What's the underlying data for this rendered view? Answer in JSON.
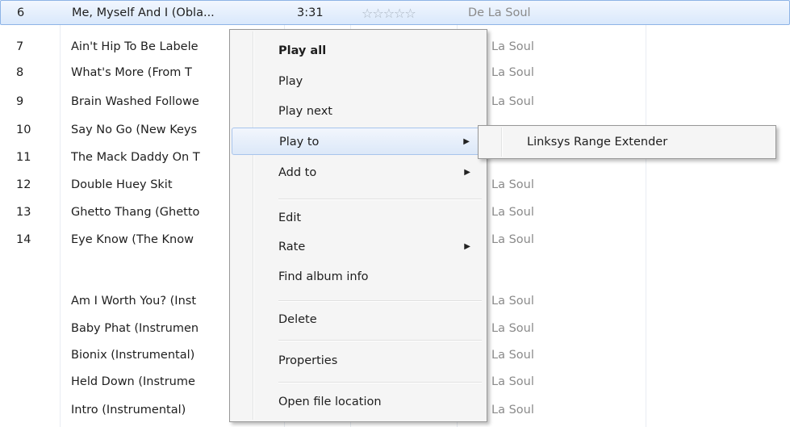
{
  "tracks": [
    {
      "num": "6",
      "title": "Me, Myself And I (Obla...",
      "length": "3:31",
      "rating": "☆☆☆☆☆",
      "artist": "De La Soul"
    },
    {
      "num": "7",
      "title": "Ain't Hip To Be Labele",
      "length": "",
      "rating": "",
      "artist": "La Soul"
    },
    {
      "num": "8",
      "title": "What's More (From T",
      "length": "",
      "rating": "",
      "artist": "La Soul"
    },
    {
      "num": "9",
      "title": "Brain Washed Followe",
      "length": "",
      "rating": "",
      "artist": "La Soul"
    },
    {
      "num": "10",
      "title": "Say No Go (New Keys",
      "length": "",
      "rating": "",
      "artist": "La Soul"
    },
    {
      "num": "11",
      "title": "The Mack Daddy On T",
      "length": "",
      "rating": "",
      "artist": "La Soul"
    },
    {
      "num": "12",
      "title": "Double Huey Skit",
      "length": "",
      "rating": "",
      "artist": "La Soul"
    },
    {
      "num": "13",
      "title": "Ghetto Thang (Ghetto",
      "length": "",
      "rating": "",
      "artist": "La Soul"
    },
    {
      "num": "14",
      "title": "Eye Know (The Know",
      "length": "",
      "rating": "",
      "artist": "La Soul"
    },
    {
      "num": "",
      "title": "",
      "length": "",
      "rating": "",
      "artist": ""
    },
    {
      "num": "",
      "title": "Am I Worth You? (Inst",
      "length": "",
      "rating": "",
      "artist": "La Soul"
    },
    {
      "num": "",
      "title": "Baby Phat (Instrumen",
      "length": "",
      "rating": "",
      "artist": "La Soul"
    },
    {
      "num": "",
      "title": "Bionix (Instrumental)",
      "length": "",
      "rating": "",
      "artist": "La Soul"
    },
    {
      "num": "",
      "title": "Held Down (Instrume",
      "length": "",
      "rating": "",
      "artist": "La Soul"
    },
    {
      "num": "",
      "title": "Intro (Instrumental)",
      "length": "",
      "rating": "",
      "artist": "La Soul"
    }
  ],
  "context_menu": {
    "items": [
      {
        "label": "Play all"
      },
      {
        "label": "Play"
      },
      {
        "label": "Play next"
      },
      {
        "label": "Play to",
        "arrow": "▶"
      },
      {
        "label": "Add to",
        "arrow": "▶"
      },
      {
        "label": "Edit"
      },
      {
        "label": "Rate",
        "arrow": "▶"
      },
      {
        "label": "Find album info"
      },
      {
        "label": "Delete"
      },
      {
        "label": "Properties"
      },
      {
        "label": "Open file location"
      }
    ]
  },
  "submenu": {
    "items": [
      {
        "label": "Linksys Range Extender"
      }
    ]
  },
  "colors": {
    "selection_border": "#8eb4e6",
    "menu_background": "#f5f5f5",
    "menu_highlight_border": "#a8c4ec"
  }
}
